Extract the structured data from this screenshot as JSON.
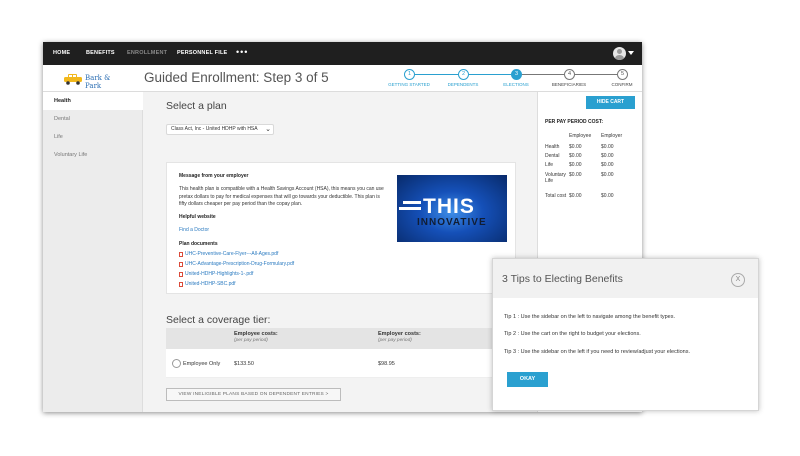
{
  "nav": {
    "home": "HOME",
    "benefits": "BENEFITS",
    "enrollment": "ENROLLMENT",
    "personnel_file": "PERSONNEL FILE",
    "more": "•••"
  },
  "header": {
    "logo_text": "Bark & Park",
    "title": "Guided Enrollment: Step 3 of 5"
  },
  "steps": [
    {
      "number": "1",
      "label": "GETTING STARTED",
      "state": "done"
    },
    {
      "number": "2",
      "label": "DEPENDENTS",
      "state": "done"
    },
    {
      "number": "3",
      "label": "ELECTIONS",
      "state": "current"
    },
    {
      "number": "4",
      "label": "BENEFICIARIES",
      "state": "future"
    },
    {
      "number": "5",
      "label": "CONFIRM",
      "state": "future"
    }
  ],
  "sidebar": {
    "items": [
      {
        "label": "Health",
        "active": true
      },
      {
        "label": "Dental",
        "active": false
      },
      {
        "label": "Life",
        "active": false
      },
      {
        "label": "Voluntary Life",
        "active": false
      }
    ]
  },
  "main": {
    "select_heading": "Select a plan",
    "plan_value": "Class Act, Inc - United HDHP with HSA",
    "message_heading": "Message from your employer",
    "message_text": "This health plan is compatible with a Health Savings Account (HSA), this means you can use pretax dollars to pay for medical expenses that will go towards your deductible. This plan is fifty dollars cheaper per pay period than the copay plan.",
    "website_heading": "Helpful website",
    "website_link": "Find a Doctor",
    "docs_heading": "Plan documents",
    "documents": [
      "UHC-Preventive-Care-Flyer---All-Ages.pdf",
      "UHC-Advantage-Prescription-Drug-Formulary.pdf",
      "United-HDHP-Highlights-1-.pdf",
      "United-HDHP-SBC.pdf"
    ],
    "video_word": "THIS",
    "video_word2": "INNOVATIVE",
    "tier_heading": "Select a coverage tier:",
    "tier_cols": {
      "employee": "Employee costs:",
      "employer": "Employer costs:",
      "sub": "(per pay period)"
    },
    "tier_rows": [
      {
        "label": "Employee Only",
        "employee": "$133.50",
        "employer": "$98.95"
      }
    ],
    "ineligible_button": "VIEW INELIGIBLE PLANS BASED ON DEPENDENT ENTRIES >"
  },
  "cart": {
    "hide_button": "HIDE CART",
    "title": "PER PAY PERIOD COST:",
    "col_employee": "Employee",
    "col_employer": "Employer",
    "rows": [
      {
        "label": "Health",
        "employee": "$0.00",
        "employer": "$0.00"
      },
      {
        "label": "Dental",
        "employee": "$0.00",
        "employer": "$0.00"
      },
      {
        "label": "Life",
        "employee": "$0.00",
        "employer": "$0.00"
      },
      {
        "label": "Voluntary Life",
        "employee": "$0.00",
        "employer": "$0.00"
      }
    ],
    "total_label": "Total cost",
    "total_employee": "$0.00",
    "total_employer": "$0.00"
  },
  "dialog": {
    "title": "3 Tips to Electing Benefits",
    "close": "X",
    "tips": [
      "Tip 1 : Use the sidebar on the left to navigate among the benefit types.",
      "Tip 2 : Use the cart on the right to budget your elections.",
      "Tip 3 : Use the sidebar on the left if you need to review/adjust your elections."
    ],
    "okay": "OKAY"
  },
  "colors": {
    "accent": "#2aa0d0",
    "nav_bg": "#1f1f1f",
    "link": "#2a7ac0",
    "pdf_icon": "#d94a3a"
  }
}
